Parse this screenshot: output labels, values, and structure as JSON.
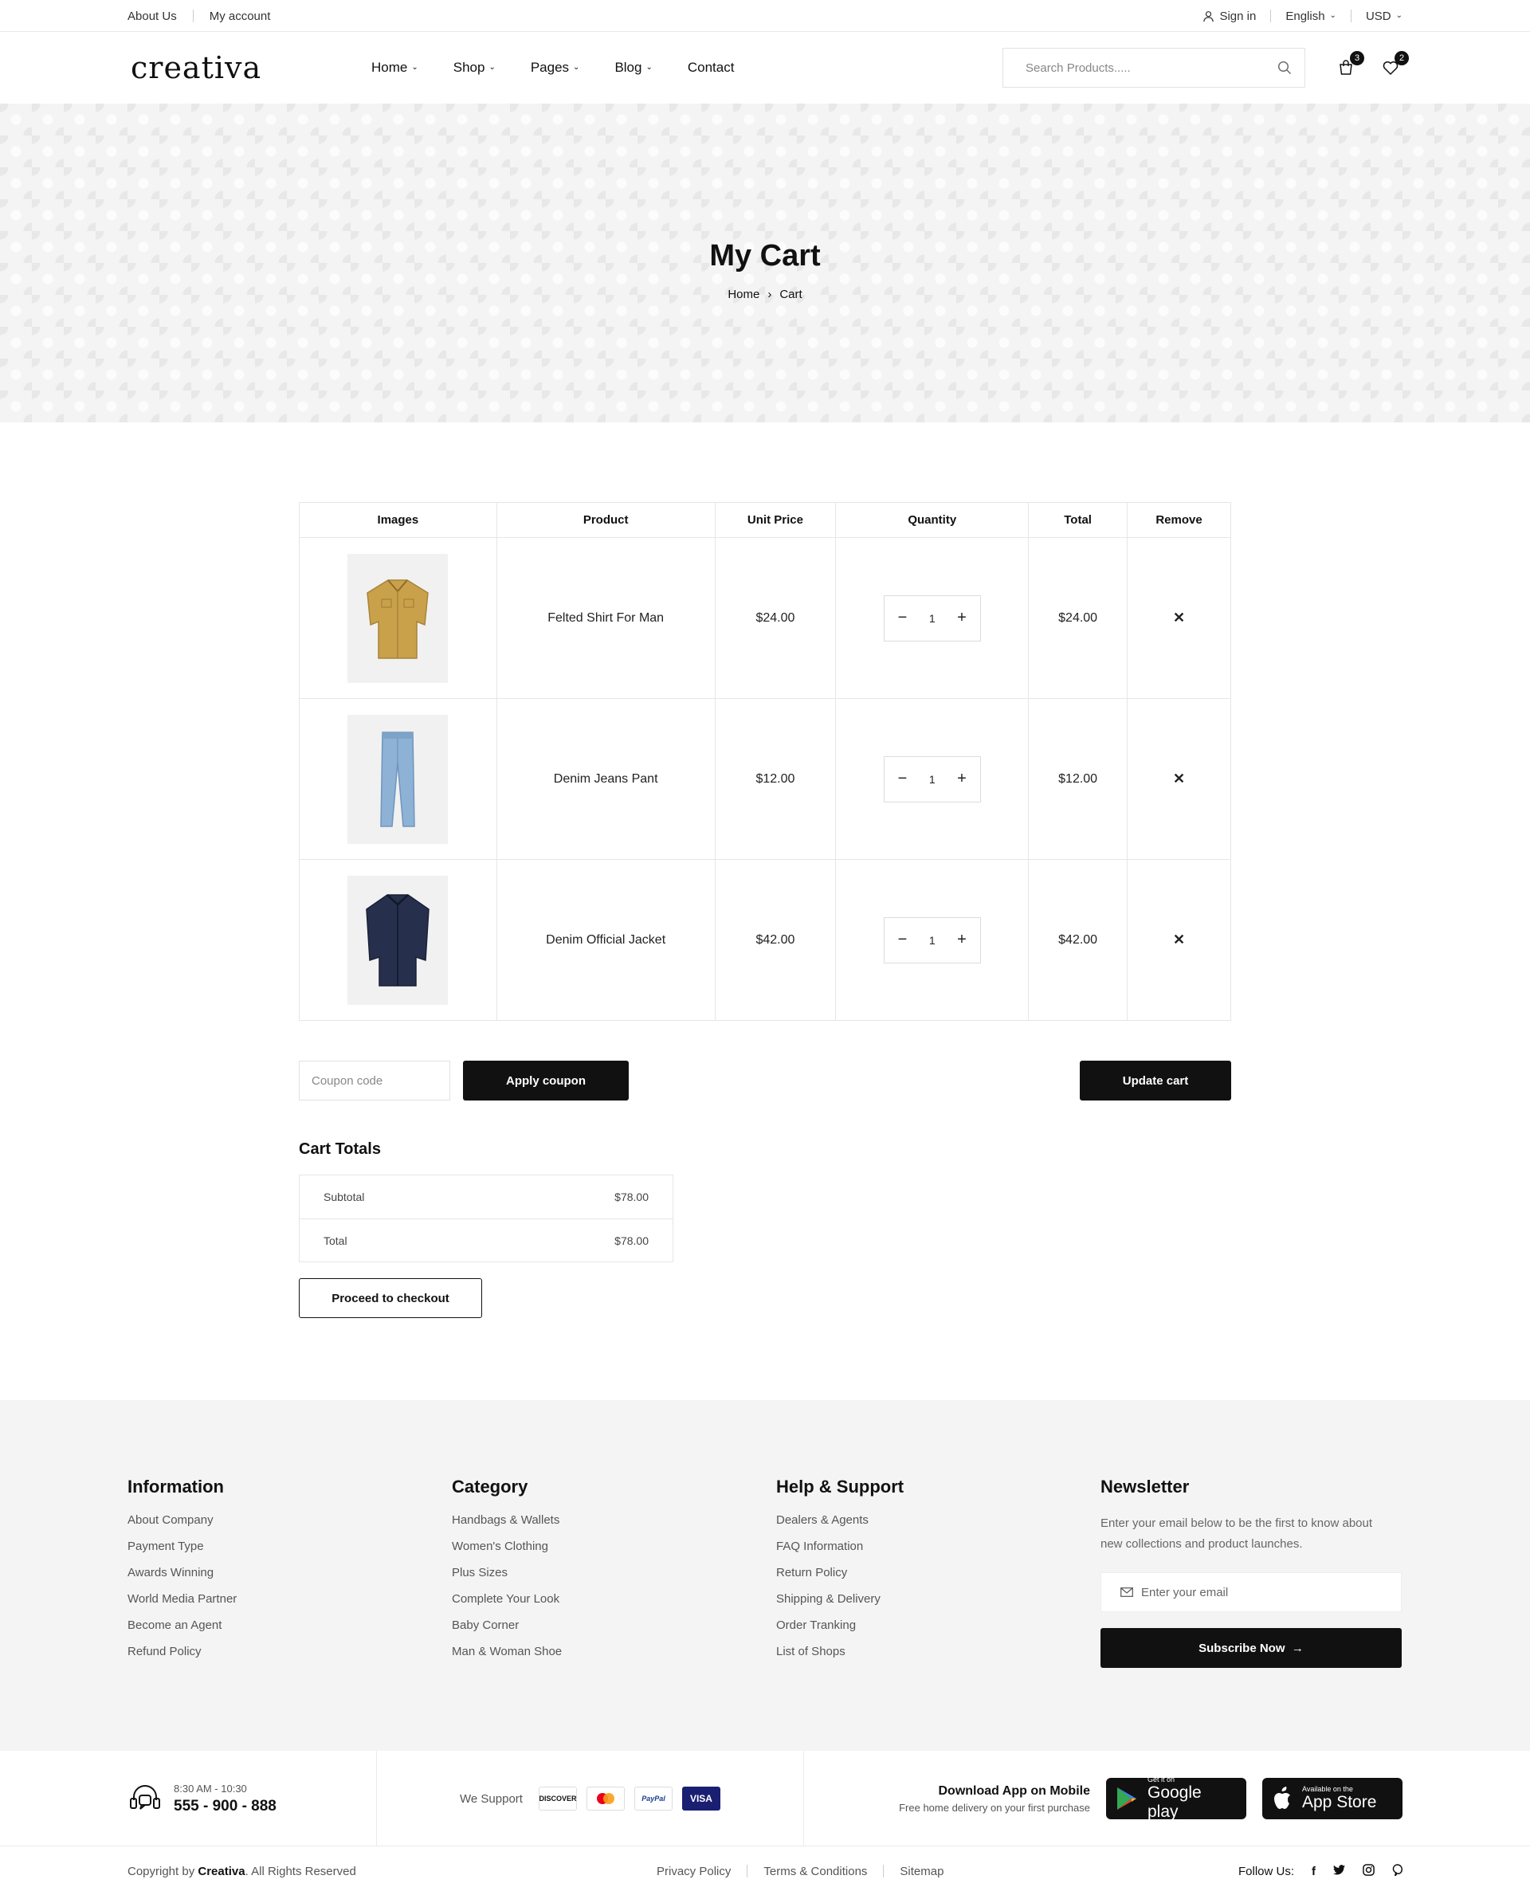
{
  "topbar": {
    "about": "About Us",
    "account": "My account",
    "signin": "Sign in",
    "language": "English",
    "currency": "USD"
  },
  "header": {
    "logo": "creativa",
    "nav": [
      "Home",
      "Shop",
      "Pages",
      "Blog",
      "Contact"
    ],
    "search_placeholder": "Search Products.....",
    "cart_count": "3",
    "wishlist_count": "2"
  },
  "hero": {
    "title": "My Cart",
    "crumb_home": "Home",
    "crumb_current": "Cart"
  },
  "cart": {
    "headers": [
      "Images",
      "Product",
      "Unit Price",
      "Quantity",
      "Total",
      "Remove"
    ],
    "items": [
      {
        "name": "Felted Shirt For Man",
        "price": "$24.00",
        "qty": "1",
        "total": "$24.00",
        "color": "#c9a14a"
      },
      {
        "name": "Denim Jeans Pant",
        "price": "$12.00",
        "qty": "1",
        "total": "$12.00",
        "color": "#8db2d6"
      },
      {
        "name": "Denim Official Jacket",
        "price": "$42.00",
        "qty": "1",
        "total": "$42.00",
        "color": "#26304d"
      }
    ],
    "coupon_placeholder": "Coupon code",
    "apply_coupon": "Apply coupon",
    "update_cart": "Update cart"
  },
  "totals": {
    "title": "Cart Totals",
    "subtotal_label": "Subtotal",
    "subtotal_value": "$78.00",
    "total_label": "Total",
    "total_value": "$78.00",
    "checkout": "Proceed to checkout"
  },
  "footer": {
    "information": {
      "title": "Information",
      "items": [
        "About Company",
        "Payment Type",
        "Awards Winning",
        "World Media Partner",
        "Become an Agent",
        "Refund Policy"
      ]
    },
    "category": {
      "title": "Category",
      "items": [
        "Handbags & Wallets",
        "Women's Clothing",
        "Plus Sizes",
        "Complete Your Look",
        "Baby Corner",
        "Man & Woman Shoe"
      ]
    },
    "help": {
      "title": "Help & Support",
      "items": [
        "Dealers & Agents",
        "FAQ Information",
        "Return Policy",
        "Shipping & Delivery",
        "Order Tranking",
        "List of Shops"
      ]
    },
    "newsletter": {
      "title": "Newsletter",
      "text": "Enter your email below to be the first to know about new collections and product launches.",
      "placeholder": "Enter your email",
      "button": "Subscribe Now"
    }
  },
  "bottom": {
    "hours": "8:30 AM - 10:30",
    "phone": "555 - 900 - 888",
    "we_support": "We Support",
    "payments": [
      "DISCOVER",
      "",
      "PayPal",
      "VISA"
    ],
    "app_title": "Download App on Mobile",
    "app_sub": "Free home delivery on your first purchase",
    "google_small": "Get it on",
    "google_big": "Google play",
    "apple_small": "Available on the",
    "apple_big": "App Store"
  },
  "copyright": {
    "prefix": "Copyright by",
    "brand": "Creativa",
    "suffix": ". All Rights Reserved",
    "links": [
      "Privacy Policy",
      "Terms & Conditions",
      "Sitemap"
    ],
    "follow": "Follow Us:",
    "socials": [
      "f",
      "t",
      "ig",
      "p"
    ]
  }
}
